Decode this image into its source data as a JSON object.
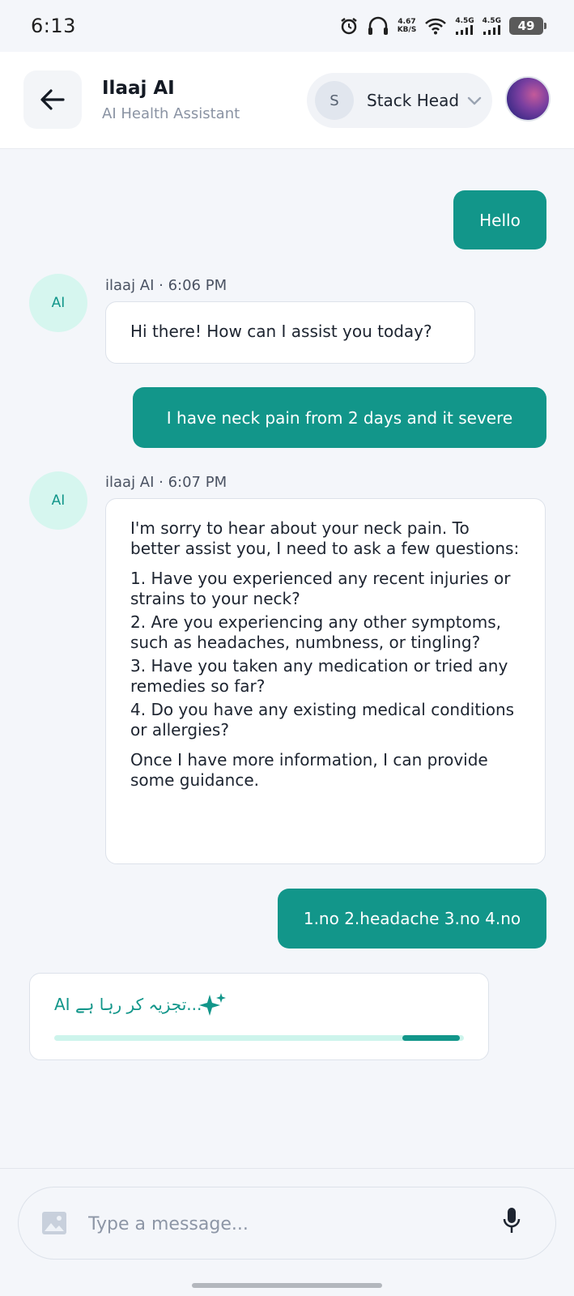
{
  "status_bar": {
    "time": "6:13",
    "net_speed_value": "4.67",
    "net_speed_unit": "KB/S",
    "sim1": "4.5G",
    "sim2": "4.5G",
    "battery": "49",
    "icons": [
      "alarm-icon",
      "headphones-icon",
      "wifi-icon",
      "signal-icon",
      "signal-icon",
      "battery-icon"
    ]
  },
  "header": {
    "title": "Ilaaj AI",
    "subtitle": "AI Health Assistant",
    "profile": {
      "initial": "S",
      "name": "Stack Head"
    }
  },
  "messages": [
    {
      "role": "user",
      "text": "Hello"
    },
    {
      "role": "ai",
      "avatar": "AI",
      "meta": "ilaaj AI · 6:06 PM",
      "text": "Hi there! How can I assist you today?"
    },
    {
      "role": "user",
      "text": "I have neck pain from 2 days and it severe"
    },
    {
      "role": "ai",
      "avatar": "AI",
      "meta": "ilaaj AI · 6:07 PM",
      "intro": "I'm sorry to hear about your neck pain. To better assist you, I need to ask a few questions:",
      "items": [
        "1. Have you experienced any recent injuries or strains to your neck?",
        "2. Are you experiencing any other symptoms, such as headaches, numbness, or tingling?",
        "3. Have you taken any medication or tried any remedies so far?",
        "4. Do you have any existing medical conditions or allergies?"
      ],
      "outro": "Once I have more information, I can provide some guidance."
    },
    {
      "role": "user",
      "text": "1.no 2.headache 3.no 4.no"
    }
  ],
  "analyzing": {
    "text": "AI تجزیہ کر رہا ہے...",
    "progress_start": 0.85,
    "progress_end": 0.99
  },
  "composer": {
    "placeholder": "Type a message...",
    "value": ""
  },
  "colors": {
    "accent": "#12968a",
    "accent_light": "#d6f6ef",
    "background": "#f4f6fa"
  }
}
